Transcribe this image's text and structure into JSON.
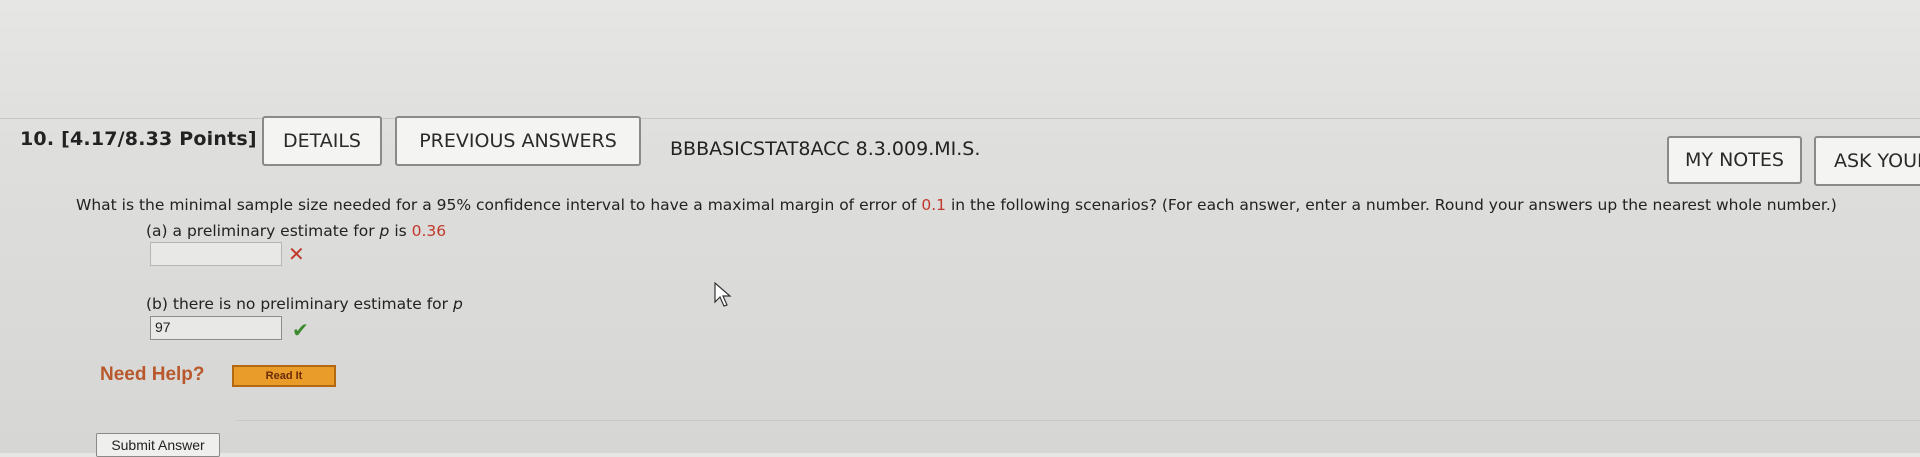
{
  "question": {
    "number": "10.",
    "points": "[4.17/8.33 Points]",
    "details_label": "DETAILS",
    "previous_answers_label": "PREVIOUS ANSWERS",
    "code": "BBBASICSTAT8ACC 8.3.009.MI.S.",
    "my_notes_label": "MY NOTES",
    "ask_label": "ASK YOUR"
  },
  "prompt": {
    "before": "What is the minimal sample size needed for a 95% confidence interval to have a maximal margin of error of ",
    "highlight": "0.1",
    "after": " in the following scenarios? (For each answer, enter a number. Round your answers up the nearest whole number.)"
  },
  "parts": {
    "a": {
      "label_prefix": "(a) a preliminary estimate for ",
      "var": "p",
      "label_mid": " is ",
      "value": "0.36",
      "answer": ""
    },
    "b": {
      "label_prefix": "(b) there is no preliminary estimate for ",
      "var": "p",
      "answer": "97"
    }
  },
  "help": {
    "label": "Need Help?",
    "read_it": "Read It"
  },
  "submit_label": "Submit Answer",
  "status": {
    "a": "incorrect",
    "b": "correct"
  },
  "colors": {
    "incorrect": "#c0392b",
    "correct": "#3c8a2e",
    "help": "#b8582c",
    "read_it_bg": "#e99c2a"
  }
}
